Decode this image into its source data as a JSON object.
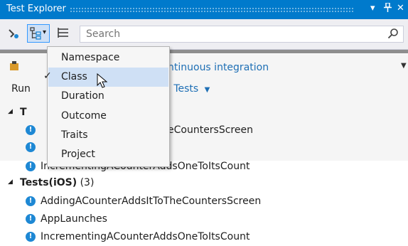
{
  "window": {
    "title": "Test Explorer",
    "buttons": {
      "dropdown": "▾",
      "pin": "ᐧ",
      "close": "✕"
    }
  },
  "toolbar": {
    "search_placeholder": "Search",
    "icons": [
      "run-settings-icon",
      "group-by-icon",
      "dropdown-arrow-icon",
      "list-icon",
      "search-icon"
    ]
  },
  "summary": {
    "ci_text": "ntinuous integration",
    "run_text": "Run",
    "tests_text": "l Tests",
    "chevron": "▼"
  },
  "tree": {
    "hidden_group_prefix": "T",
    "hidden_items": [
      "eCountersScreen",
      "IncrementingACounterAddsOneToItsCount"
    ],
    "group": {
      "name": "Tests(iOS)",
      "count": "(3)"
    },
    "items": [
      "AddingACounterAddsItToTheCountersScreen",
      "AppLaunches",
      "IncrementingACounterAddsOneToItsCount"
    ]
  },
  "group_menu": {
    "items": [
      "Namespace",
      "Class",
      "Duration",
      "Outcome",
      "Traits",
      "Project"
    ],
    "checked": "Class",
    "check_mark": "✓"
  },
  "colors": {
    "accent": "#007acc",
    "link": "#1e6fb5",
    "info_icon": "#1e88d4",
    "menu_highlight": "#cfe0f5"
  }
}
